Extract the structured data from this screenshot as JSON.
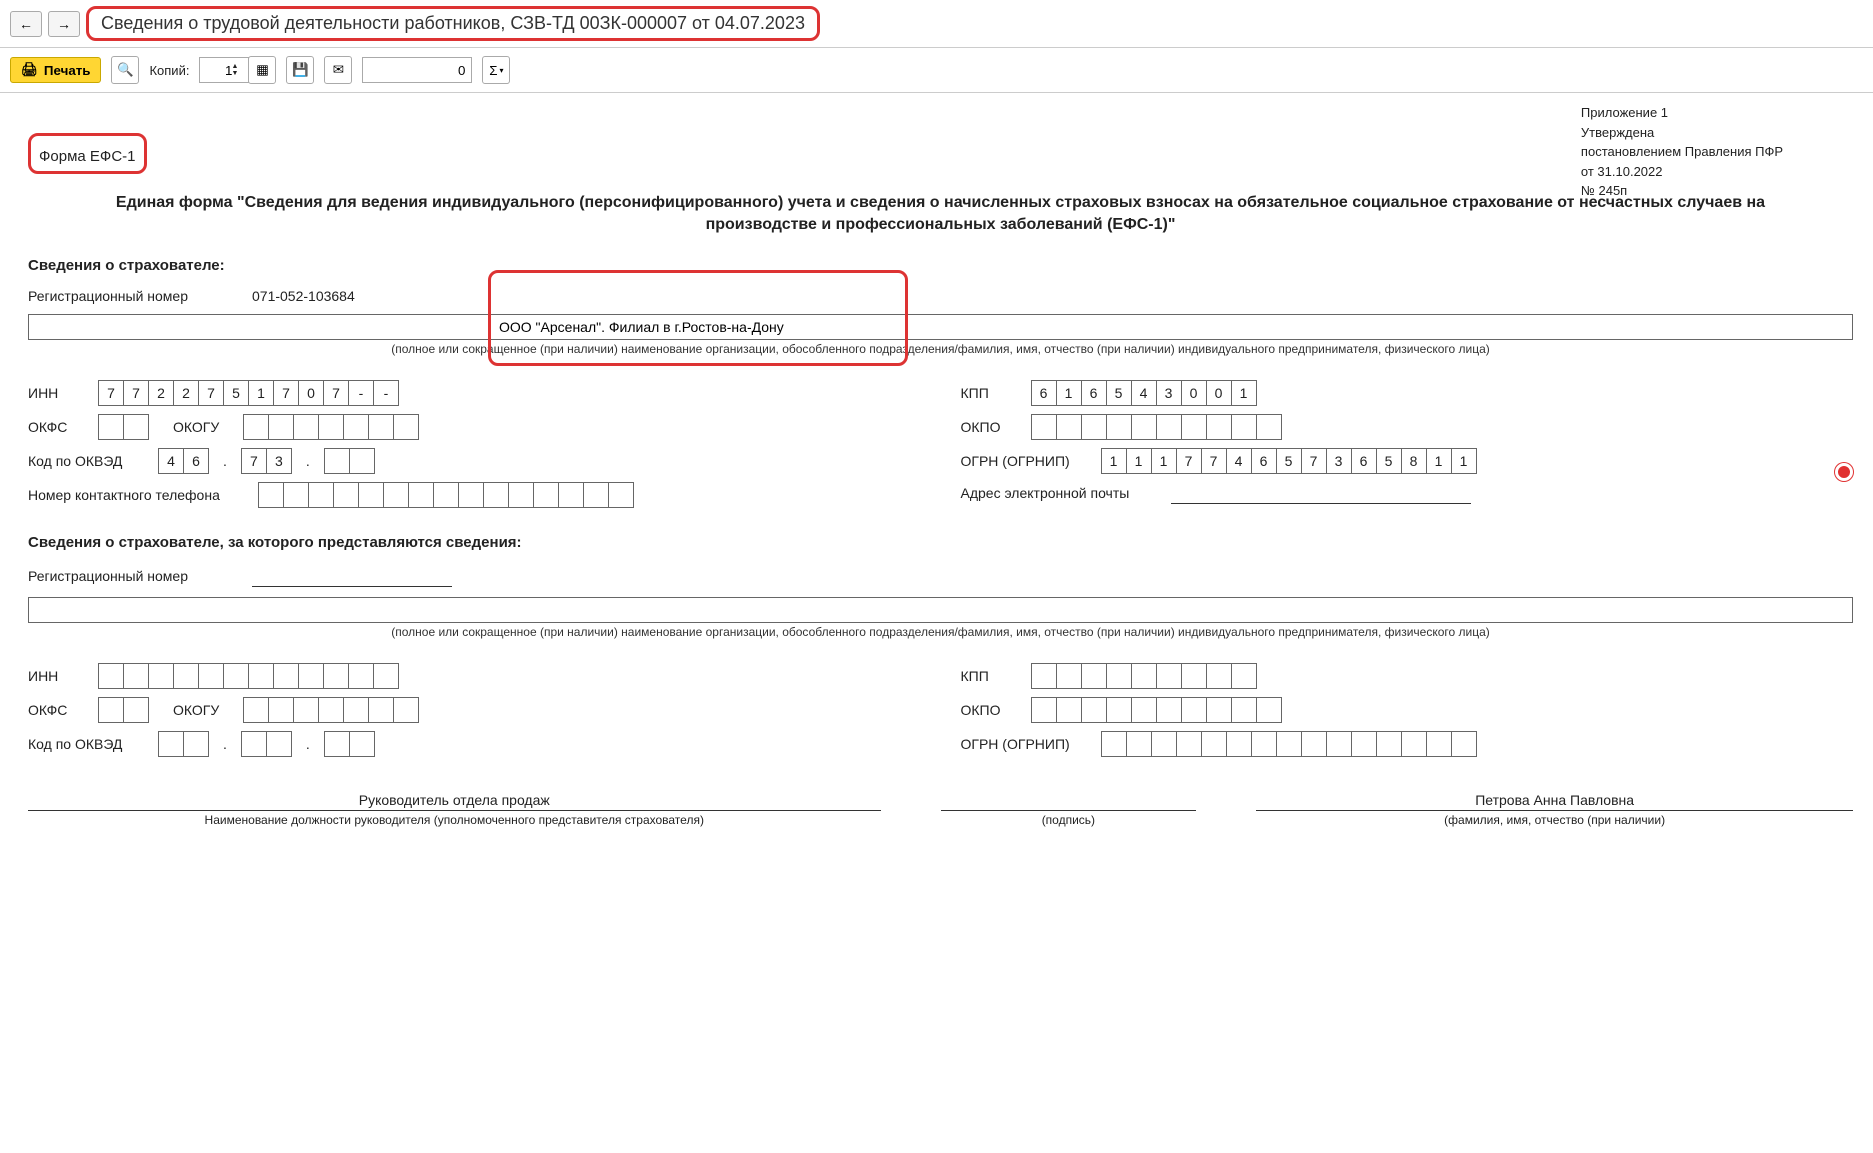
{
  "header": {
    "title": "Сведения о трудовой деятельности работников, СЗВ-ТД 00ЗК-000007 от 04.07.2023"
  },
  "toolbar": {
    "print_label": "Печать",
    "copies_label": "Копий:",
    "copies_value": "1",
    "num_value": "0",
    "sigma_label": "Σ"
  },
  "approval": {
    "line1": "Приложение 1",
    "line2": "Утверждена",
    "line3": "постановлением Правления ПФР",
    "line4": "от 31.10.2022",
    "line5": "№ 245п"
  },
  "form_label": "Форма ЕФС-1",
  "main_title": "Единая форма \"Сведения для ведения индивидуального (персонифицированного) учета и сведения о начисленных страховых взносах на обязательное социальное страхование от несчастных случаев на производстве и профессиональных заболеваний (ЕФС-1)\"",
  "section1": {
    "head": "Сведения о страхователе:",
    "reg_label": "Регистрационный номер",
    "reg_value": "071-052-103684",
    "org_name": "ООО \"Арсенал\". Филиал в г.Ростов-на-Дону",
    "org_hint": "(полное или сокращенное (при наличии) наименование организации, обособленного подразделения/фамилия, имя, отчество (при наличии) индивидуального предпринимателя, физического лица)",
    "inn_label": "ИНН",
    "inn": [
      "7",
      "7",
      "2",
      "2",
      "7",
      "5",
      "1",
      "7",
      "0",
      "7",
      "-",
      "-"
    ],
    "okfs_label": "ОКФС",
    "okfs": [
      "",
      ""
    ],
    "okogu_label": "ОКОГУ",
    "okogu": [
      "",
      "",
      "",
      "",
      "",
      "",
      ""
    ],
    "okved_label": "Код по ОКВЭД",
    "okved1": [
      "4",
      "6"
    ],
    "okved2": [
      "7",
      "3"
    ],
    "okved3": [
      "",
      ""
    ],
    "phone_label": "Номер контактного телефона",
    "kpp_label": "КПП",
    "kpp": [
      "6",
      "1",
      "6",
      "5",
      "4",
      "3",
      "0",
      "0",
      "1"
    ],
    "okpo_label": "ОКПО",
    "okpo": [
      "",
      "",
      "",
      "",
      "",
      "",
      "",
      "",
      "",
      ""
    ],
    "ogrn_label": "ОГРН (ОГРНИП)",
    "ogrn": [
      "1",
      "1",
      "1",
      "7",
      "7",
      "4",
      "6",
      "5",
      "7",
      "3",
      "6",
      "5",
      "8",
      "1",
      "1"
    ],
    "email_label": "Адрес электронной почты"
  },
  "section2": {
    "head": "Сведения о страхователе, за которого представляются сведения:",
    "reg_label": "Регистрационный номер",
    "org_hint": "(полное или сокращенное (при наличии) наименование организации, обособленного подразделения/фамилия, имя, отчество (при наличии) индивидуального предпринимателя, физического лица)",
    "inn_label": "ИНН",
    "inn": [
      "",
      "",
      "",
      "",
      "",
      "",
      "",
      "",
      "",
      "",
      "",
      ""
    ],
    "okfs_label": "ОКФС",
    "okfs": [
      "",
      ""
    ],
    "okogu_label": "ОКОГУ",
    "okogu": [
      "",
      "",
      "",
      "",
      "",
      "",
      ""
    ],
    "okved_label": "Код по ОКВЭД",
    "okved1": [
      "",
      ""
    ],
    "okved2": [
      "",
      ""
    ],
    "okved3": [
      "",
      ""
    ],
    "kpp_label": "КПП",
    "kpp": [
      "",
      "",
      "",
      "",
      "",
      "",
      "",
      "",
      ""
    ],
    "okpo_label": "ОКПО",
    "okpo": [
      "",
      "",
      "",
      "",
      "",
      "",
      "",
      "",
      "",
      ""
    ],
    "ogrn_label": "ОГРН (ОГРНИП)",
    "ogrn": [
      "",
      "",
      "",
      "",
      "",
      "",
      "",
      "",
      "",
      "",
      "",
      "",
      "",
      "",
      ""
    ]
  },
  "signatures": {
    "position": "Руководитель отдела продаж",
    "position_hint": "Наименование должности руководителя (уполномоченного представителя страхователя)",
    "sign_hint": "(подпись)",
    "fio": "Петрова Анна Павловна",
    "fio_hint": "(фамилия, имя, отчество (при наличии)"
  }
}
